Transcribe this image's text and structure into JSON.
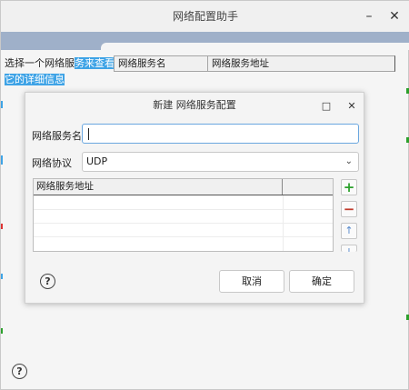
{
  "main_window": {
    "title": "网络配置助手",
    "minimize_glyph": "–",
    "close_glyph": "✕",
    "intro_line1_plain": "选择一个网络服",
    "intro_line1_selected": "务来查看",
    "intro_line2_selected": "它的详细信息",
    "table_headers": [
      "网络服务名",
      "网络服务地址"
    ],
    "help_glyph": "?"
  },
  "dialog": {
    "title": "新建 网络服务配置",
    "maximize_glyph": "□",
    "close_glyph": "✕",
    "name_label": "网络服务名",
    "name_value": "",
    "protocol_label": "网络协议",
    "protocol_value": "UDP",
    "address_table_header": "网络服务地址",
    "add_glyph": "+",
    "remove_glyph": "−",
    "up_glyph": "↑",
    "down_glyph": "↓",
    "help_glyph": "?",
    "cancel_label": "取消",
    "ok_label": "确定"
  },
  "colors": {
    "banner": "#9fb0c9",
    "selection": "#3ea3e6",
    "add_green": "#2ca02c",
    "remove_red": "#c0392b"
  }
}
